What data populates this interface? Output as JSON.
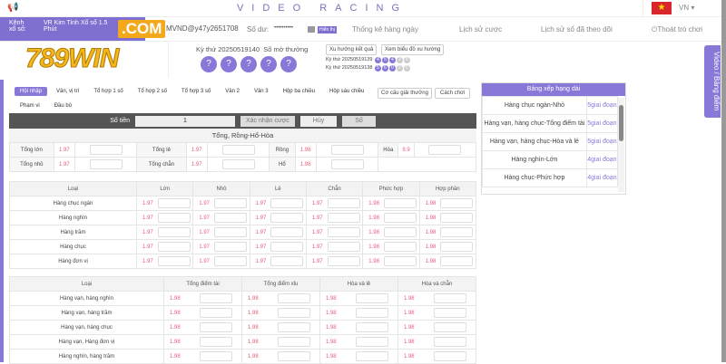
{
  "header": {
    "title": "VIDEO RACING",
    "lang": "VN",
    "user": "MVND@y47y2651708",
    "balance_label": "Số dư:",
    "balance_masked": "••••••••••",
    "show_button": "Hiển thị"
  },
  "channel": {
    "label": "Kênh xổ số:",
    "name": "VR Kim Tinh Xổ số 1.5 Phút"
  },
  "nav": [
    "Thống kê hàng ngày",
    "Lịch sử cược",
    "Lịch sử số đã theo dõi",
    "Thoát trò chơi"
  ],
  "logo": {
    "text": "789WIN",
    "suffix": ".COM"
  },
  "draw": {
    "current_label": "Kỳ thứ 20250519140",
    "result_label": "Số mở thưởng",
    "balls": [
      "?",
      "?",
      "?",
      "?",
      "?"
    ],
    "trend_button": "Xu hướng kết quả",
    "chart_button": "Xem biểu đồ xu hướng",
    "history": [
      {
        "label": "Kỳ thứ 20250519139",
        "nums": [
          "4",
          "5",
          "4",
          "3",
          "8"
        ]
      },
      {
        "label": "Kỳ thứ 20250519138",
        "nums": [
          "5",
          "6",
          "0",
          "2",
          "6"
        ]
      }
    ]
  },
  "tabs": [
    "Hội nhập",
    "Vân, vị trí",
    "Tổ hợp 1 số",
    "Tổ hợp 2 số",
    "Tổ hợp 3 số",
    "Vân 2",
    "Vân 3",
    "Hộp ba chiều",
    "Hộp sáu chiều",
    "Phạm vi",
    "Đầu bò"
  ],
  "tab_buttons": [
    "Cơ cấu giải thưởng",
    "Cách chơi"
  ],
  "betbar": {
    "amount_label": "Số tiền",
    "amount": "1",
    "confirm": "Xác nhận cược",
    "cancel": "Hủy",
    "number": "Số"
  },
  "section1": {
    "title": "Tổng, Rồng-Hổ-Hòa",
    "rows": [
      [
        [
          "Tổng lớn",
          "1.97"
        ],
        [
          "Tổng lẻ",
          "1.97"
        ],
        [
          "Rồng",
          "1.98"
        ],
        [
          "Hòa",
          "9.9"
        ]
      ],
      [
        [
          "Tổng nhỏ",
          "1.97"
        ],
        [
          "Tổng chẵn",
          "1.97"
        ],
        [
          "Hổ",
          "1.98"
        ]
      ]
    ]
  },
  "table1": {
    "headers": [
      "Loại",
      "Lớn",
      "Nhỏ",
      "Lẻ",
      "Chẵn",
      "Phức hợp",
      "Hợp phần"
    ],
    "rows": [
      [
        "Hàng chục ngàn",
        "1.97",
        "1.97",
        "1.97",
        "1.97",
        "1.98",
        "1.98"
      ],
      [
        "Hàng nghìn",
        "1.97",
        "1.97",
        "1.97",
        "1.97",
        "1.98",
        "1.98"
      ],
      [
        "Hàng trăm",
        "1.97",
        "1.97",
        "1.97",
        "1.97",
        "1.98",
        "1.98"
      ],
      [
        "Hàng chục",
        "1.97",
        "1.97",
        "1.97",
        "1.97",
        "1.98",
        "1.98"
      ],
      [
        "Hàng đơn vị",
        "1.97",
        "1.97",
        "1.97",
        "1.97",
        "1.98",
        "1.98"
      ]
    ]
  },
  "table2": {
    "headers": [
      "Loại",
      "Tổng điểm tài",
      "Tổng điểm xỉu",
      "Hòa và lẻ",
      "Hòa và chẵn"
    ],
    "rows": [
      [
        "Hàng vạn, hàng nghìn",
        "1.98",
        "1.98",
        "1.98",
        "1.98"
      ],
      [
        "Hàng vạn, hàng trăm",
        "1.98",
        "1.98",
        "1.98",
        "1.98"
      ],
      [
        "Hàng vạn, hàng chục",
        "1.98",
        "1.98",
        "1.98",
        "1.98"
      ],
      [
        "Hàng vạn, Hàng đơn vị",
        "1.98",
        "1.98",
        "1.98",
        "1.98"
      ],
      [
        "Hàng nghìn, hàng trăm",
        "1.98",
        "1.98",
        "1.98",
        "1.98"
      ]
    ]
  },
  "ranking": {
    "title": "Bảng xếp hạng dài",
    "rows": [
      [
        "Hàng chục ngàn-Nhỏ",
        "5giai đoạn"
      ],
      [
        "Hàng vạn, hàng chục-Tổng điểm tài",
        "5giai đoạn"
      ],
      [
        "Hàng vạn, hàng chục-Hòa và lẻ",
        "5giai đoạn"
      ],
      [
        "Hàng nghìn-Lớn",
        "4giai đoạn"
      ],
      [
        "Hàng chục-Phức hợp",
        "4giai đoạn"
      ]
    ]
  },
  "side_tab": "Video / Bảng điểm"
}
